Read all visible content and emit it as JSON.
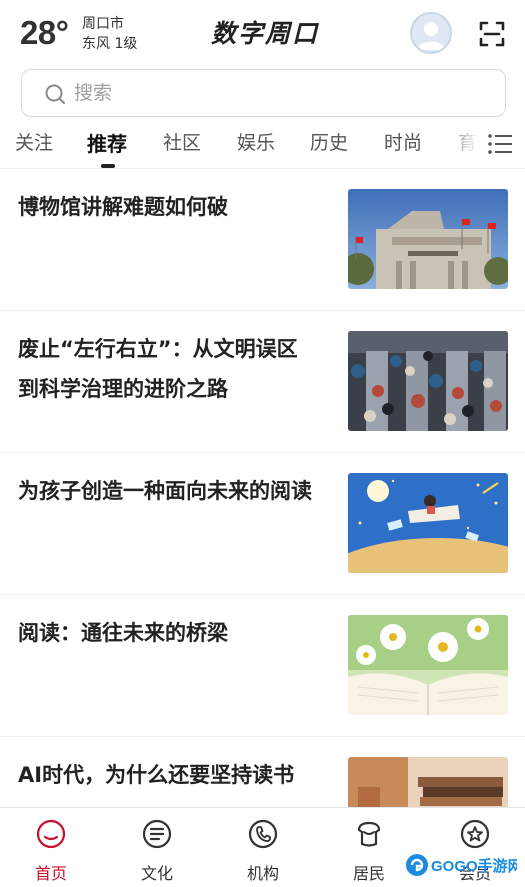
{
  "header": {
    "temperature": "28°",
    "city": "周口市",
    "wind": "东风  1级",
    "brand": "数字周口"
  },
  "search": {
    "placeholder": "搜索"
  },
  "tabs": [
    {
      "label": "关注"
    },
    {
      "label": "推荐"
    },
    {
      "label": "社区"
    },
    {
      "label": "娱乐"
    },
    {
      "label": "历史"
    },
    {
      "label": "时尚"
    },
    {
      "label": "育"
    }
  ],
  "active_tab": "推荐",
  "articles": [
    {
      "title": "博物馆讲解难题如何破"
    },
    {
      "title": "废止“左行右立”：从文明误区到科学治理的进阶之路"
    },
    {
      "title": "为孩子创造一种面向未来的阅读"
    },
    {
      "title": "阅读：通往未来的桥梁"
    },
    {
      "title": "AI时代，为什么还要坚持读书"
    }
  ],
  "bottom_nav": [
    {
      "label": "首页",
      "icon": "home-icon"
    },
    {
      "label": "文化",
      "icon": "culture-icon"
    },
    {
      "label": "机构",
      "icon": "phone-icon"
    },
    {
      "label": "居民",
      "icon": "resident-icon"
    },
    {
      "label": "会员",
      "icon": "member-star-icon"
    }
  ],
  "watermark": "GOGO手游网",
  "colors": {
    "accent": "#c8102e",
    "text": "#222222",
    "inactive": "#333333"
  }
}
